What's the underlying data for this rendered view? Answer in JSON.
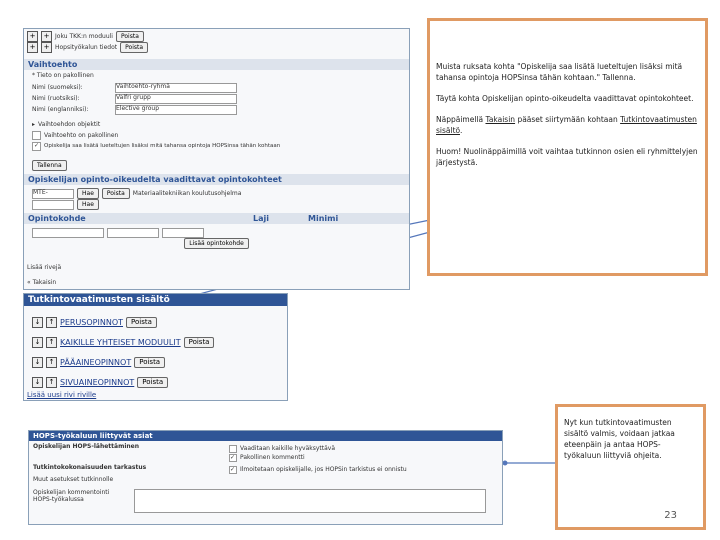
{
  "panel1": {
    "rows_top": [
      "Joku TKK:n moduuli",
      "Hopsityökalun tiedot"
    ],
    "remove_label": "Poista",
    "vaihtoehto_header": "Vaihtoehto",
    "tieto_title": "* Tieto on pakollinen",
    "fields": [
      {
        "label": "Nimi (suomeksi):",
        "value": "Vaihtoehto-ryhmä"
      },
      {
        "label": "Nimi (ruotsiksi):",
        "value": "Valfri grupp"
      },
      {
        "label": "Nimi (englanniksi):",
        "value": "Elective group"
      }
    ],
    "vaihtoehdon_objektit": "Vaihtoehdon objektit",
    "checkbox_pakollinen": "Vaihtoehto on pakollinen",
    "checkbox_lisaa": "Opiskelija saa lisätä lueteltujen lisäksi mitä tahansa opintoja HOPSinsa tähän kohtaan",
    "save_label": "Tallenna",
    "opiskelijan_header": "Opiskelijan opinto-oikeudelta vaadittavat opintokohteet",
    "code_value": "MTE-",
    "hae_label": "Hae",
    "koulutusohjelma_text": "Materiaalitekniikan koulutusohjelma",
    "opintokohde_header": "Opintokohde",
    "laji_header": "Laji",
    "minimi_header": "Minimi",
    "lisaa_label": "Lisää",
    "lisaa_opintokohde": "Lisää opintokohde",
    "lisaa_rivi": "Lisää rivejä",
    "takaisin": "« Takaisin"
  },
  "panel2": {
    "header": "Tutkintovaatimusten sisältö",
    "items": [
      {
        "label": "PERUSOPINNOT",
        "button": "Poista"
      },
      {
        "label": "KAIKILLE YHTEISET MODUULIT",
        "button": "Poista"
      },
      {
        "label": "PÄÄAINEOPINNOT",
        "button": "Poista"
      },
      {
        "label": "SIVUAINEOPINNOT",
        "button": "Poista"
      }
    ],
    "add_link": "Lisää uusi rivi riville"
  },
  "panel3": {
    "header": "HOPS-työkaluun liittyvät asiat",
    "rows": [
      {
        "label": "Opiskelijan HOPS-lähettäminen",
        "options": [
          "Vaaditaan kaikille hyväksyttävä",
          "Pakollinen kommentti"
        ]
      },
      {
        "label": "Tutkintokokonaisuuden tarkastus",
        "options": [
          "Ilmoitetaan opiskelijalle, jos HOPSin tarkistus ei onnistu"
        ]
      }
    ],
    "muu_label": "Muut asetukset tutkinnolle",
    "comment_label": "Opiskelijan kommentointi HOPS-työkalussa",
    "comment_value": ""
  },
  "note1": {
    "p1": "Muista ruksata kohta \"Opiskelija saa lisätä lueteltujen lisäksi mitä tahansa opintoja HOPSinsa tähän kohtaan.\" Tallenna.",
    "p2": "Täytä kohta Opiskelijan opinto-oikeudelta vaadittavat opintokohteet.",
    "p3_pre": "Näppäimellä ",
    "p3_link": "Takaisin",
    "p3_mid": " pääset siirtymään kohtaan ",
    "p3_link2": "Tutkintovaatimusten sisältö",
    "p3_post": ".",
    "p4": "Huom! Nuolinäppäimillä voit vaihtaa tutkinnon osien eli ryhmittelyjen järjestystä."
  },
  "note2": {
    "text": "Nyt kun tutkintovaatimusten sisältö valmis, voidaan jatkaa eteenpäin ja antaa HOPS-työkaluun liittyviä ohjeita."
  },
  "page_number": "23",
  "colors": {
    "accent_bar": "#2f5596",
    "note_border": "#e09a63",
    "arrow": "#5577bb"
  }
}
